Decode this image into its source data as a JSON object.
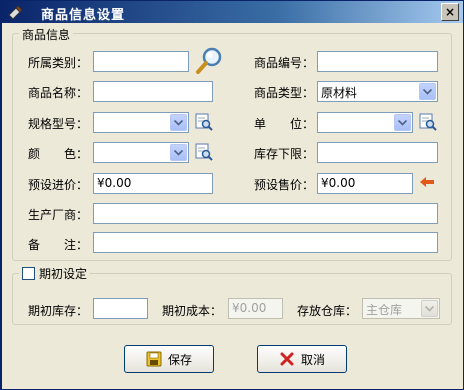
{
  "window": {
    "title": "商品信息设置",
    "close_glyph": "×"
  },
  "product_info": {
    "legend": "商品信息",
    "category_label": "所属类别：",
    "category_value": "",
    "code_label": "商品编号：",
    "code_value": "",
    "name_label": "商品名称：",
    "name_value": "",
    "type_label": "商品类型：",
    "type_value": "原材料",
    "spec_label": "规格型号：",
    "spec_value": "",
    "unit_label": "单　　位：",
    "unit_value": "",
    "color_label": "颜　　色：",
    "color_value": "",
    "stock_min_label": "库存下限：",
    "stock_min_value": "",
    "purchase_price_label": "预设进价：",
    "purchase_price_value": "¥0.00",
    "sale_price_label": "预设售价：",
    "sale_price_value": "¥0.00",
    "manufacturer_label": "生产厂商：",
    "manufacturer_value": "",
    "remark_label": "备　　注：",
    "remark_value": ""
  },
  "initial": {
    "legend": "期初设定",
    "checked": false,
    "stock_label": "期初库存：",
    "stock_value": "",
    "cost_label": "期初成本：",
    "cost_value": "¥0.00",
    "warehouse_label": "存放仓库：",
    "warehouse_value": "主仓库"
  },
  "buttons": {
    "save": "保存",
    "cancel": "取消"
  },
  "colors": {
    "title_bar": "#0a246a",
    "accent_arrow": "#e05a1c",
    "save_icon": "#c8a000",
    "cancel_icon": "#d02020"
  },
  "icons": [
    "search-icon",
    "lookup-icon",
    "arrow-left-icon",
    "save-icon",
    "cancel-icon",
    "close-icon"
  ]
}
